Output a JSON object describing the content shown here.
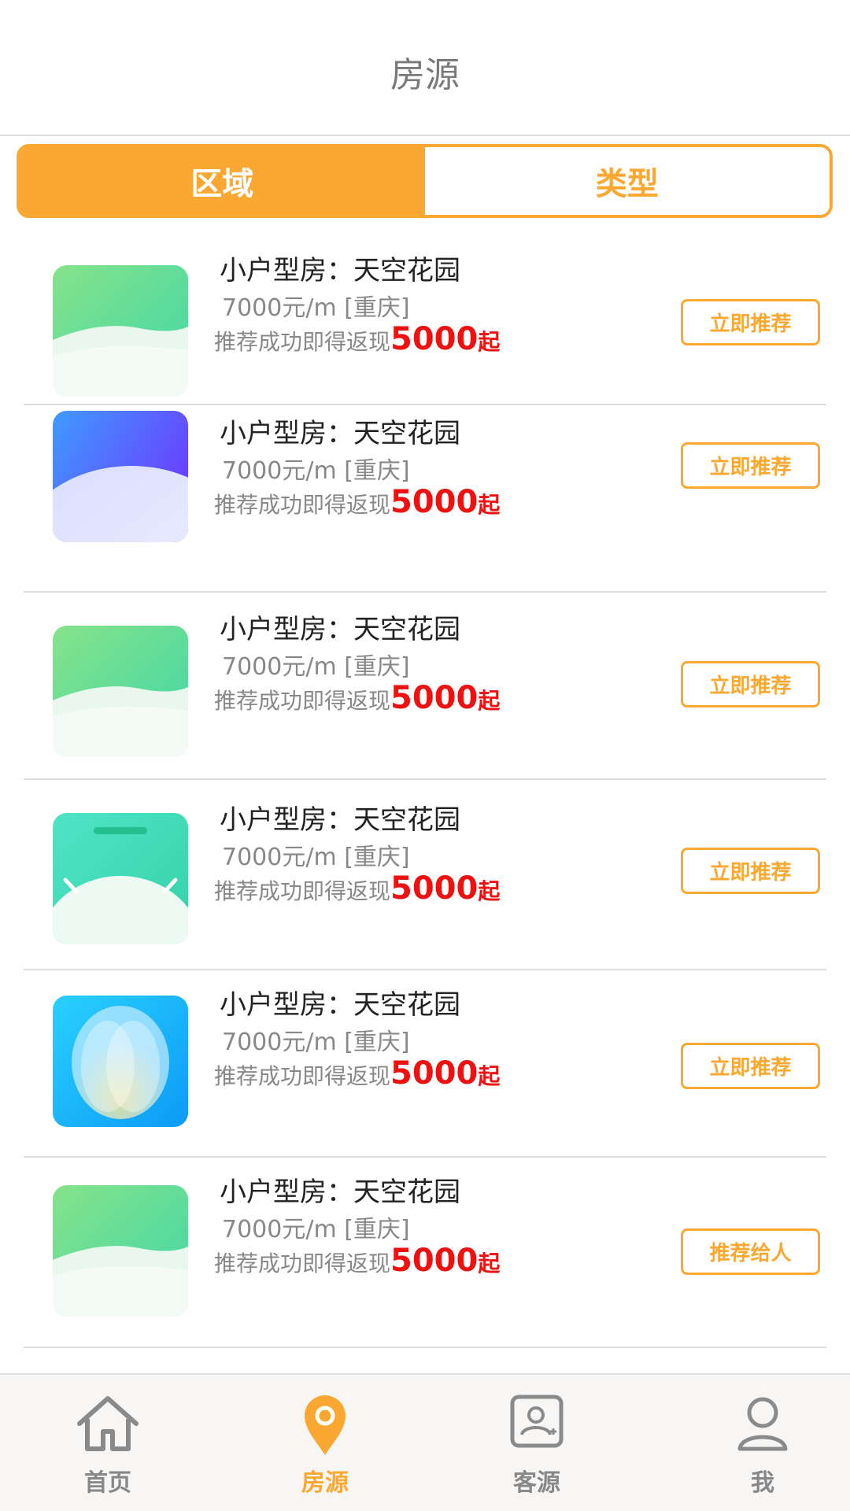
{
  "header": {
    "title": "房源"
  },
  "tabs": [
    {
      "label": "区域",
      "active": true
    },
    {
      "label": "类型",
      "active": false
    }
  ],
  "listings": [
    {
      "title": "小户型房：天空花园",
      "price": "7000元/m [重庆]",
      "rebate_text": "推荐成功即得返现",
      "rebate_amount": "5000",
      "rebate_suffix": "起",
      "button": "立即推荐",
      "thumb": "green-wave-icon"
    },
    {
      "title": "小户型房：天空花园",
      "price": "7000元/m [重庆]",
      "rebate_text": "推荐成功即得返现",
      "rebate_amount": "5000",
      "rebate_suffix": "起",
      "button": "立即推荐",
      "thumb": "blue-purple-dome-icon"
    },
    {
      "title": "小户型房：天空花园",
      "price": "7000元/m [重庆]",
      "rebate_text": "推荐成功即得返现",
      "rebate_amount": "5000",
      "rebate_suffix": "起",
      "button": "立即推荐",
      "thumb": "green-wave-icon"
    },
    {
      "title": "小户型房：天空花园",
      "price": "7000元/m [重庆]",
      "rebate_text": "推荐成功即得返现",
      "rebate_amount": "5000",
      "rebate_suffix": "起",
      "button": "立即推荐",
      "thumb": "teal-dome-icon"
    },
    {
      "title": "小户型房：天空花园",
      "price": "7000元/m [重庆]",
      "rebate_text": "推荐成功即得返现",
      "rebate_amount": "5000",
      "rebate_suffix": "起",
      "button": "立即推荐",
      "thumb": "cyan-petal-icon"
    },
    {
      "title": "小户型房：天空花园",
      "price": "7000元/m [重庆]",
      "rebate_text": "推荐成功即得返现",
      "rebate_amount": "5000",
      "rebate_suffix": "起",
      "button": "推荐给人",
      "thumb": "green-wave-icon"
    }
  ],
  "nav": [
    {
      "label": "首页",
      "icon": "home-icon",
      "active": false
    },
    {
      "label": "房源",
      "icon": "location-pin-icon",
      "active": true
    },
    {
      "label": "客源",
      "icon": "add-contact-icon",
      "active": false
    },
    {
      "label": "我",
      "icon": "user-icon",
      "active": false
    }
  ],
  "colors": {
    "accent": "#fba832",
    "highlight": "#ee1111",
    "divider": "#dddddd"
  }
}
